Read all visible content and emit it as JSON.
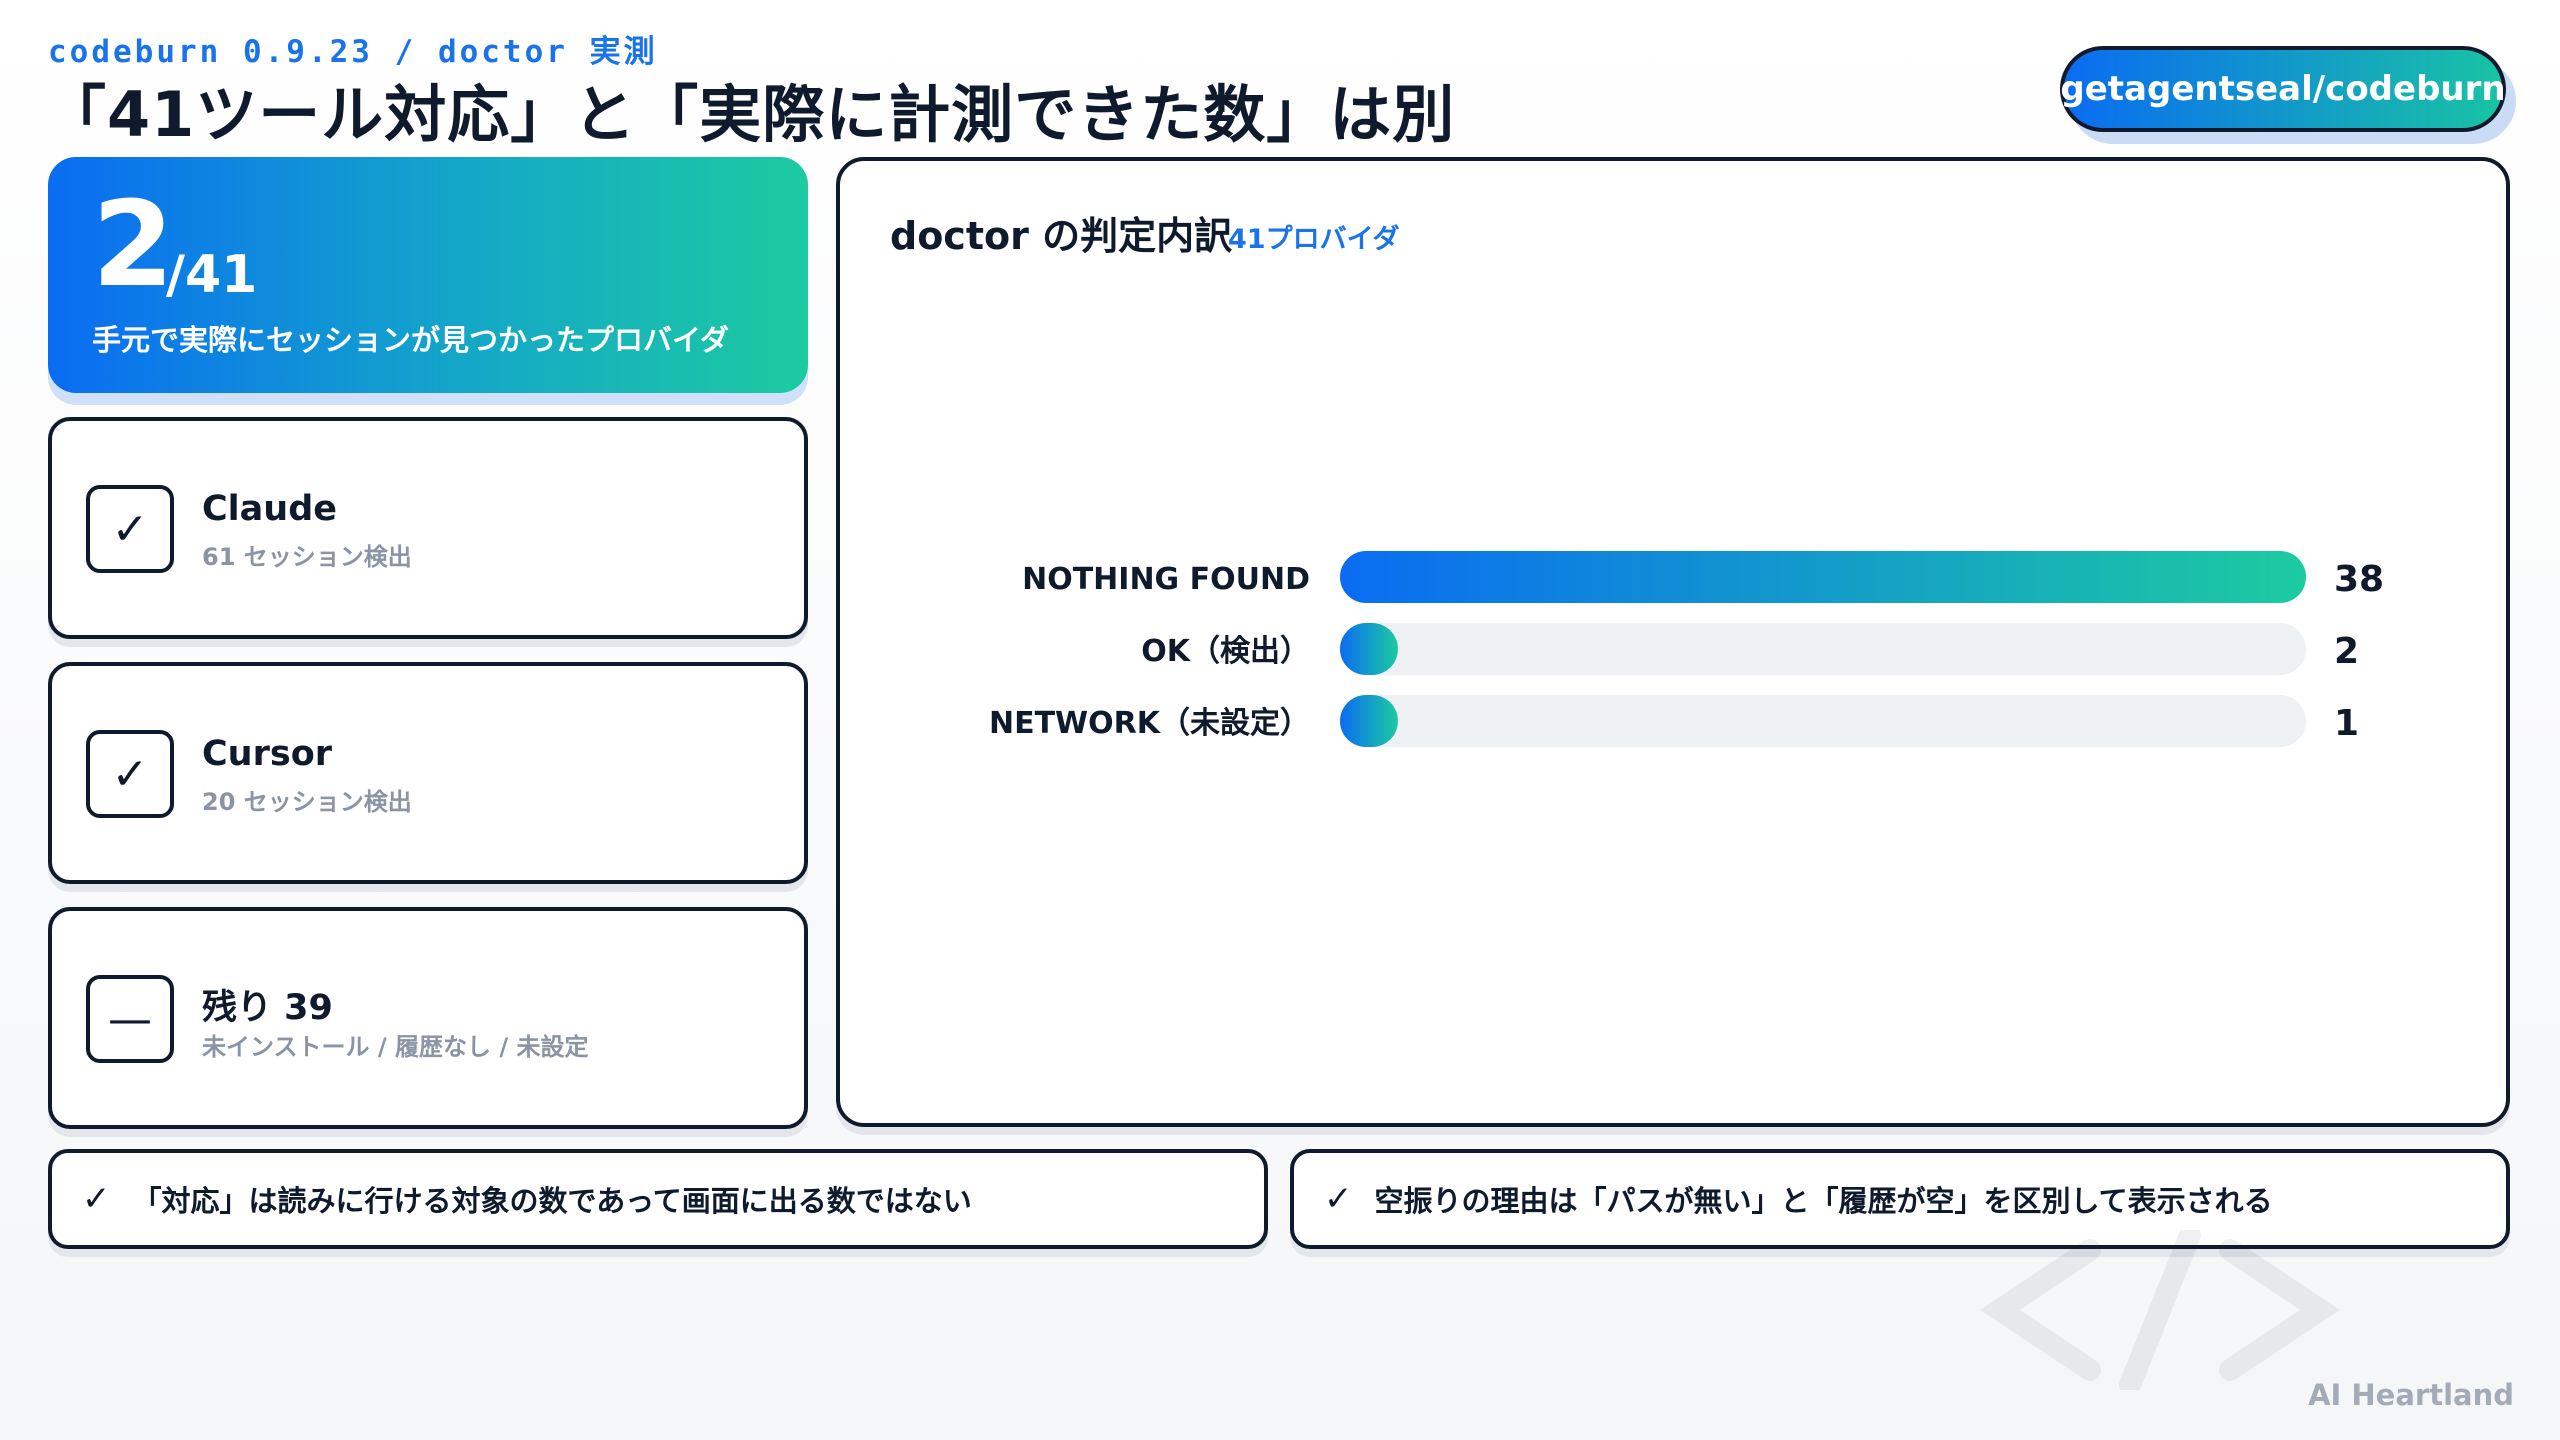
{
  "header": {
    "kicker": "codeburn 0.9.23 / doctor 実測",
    "title": "「41ツール対応」と「実際に計測できた数」は別",
    "repo": "getagentseal/codeburn"
  },
  "hero": {
    "count": "2",
    "total": "/41",
    "caption": "手元で実際にセッションが見つかったプロバイダ"
  },
  "cards": [
    {
      "icon": "check-icon",
      "mark": "✓",
      "name": "Claude",
      "sub": "61 セッション検出"
    },
    {
      "icon": "check-icon",
      "mark": "✓",
      "name": "Cursor",
      "sub": "20 セッション検出"
    },
    {
      "icon": "dash-icon",
      "mark": "—",
      "name": "残り 39",
      "sub": "未インストール / 履歴なし / 未設定"
    }
  ],
  "panel": {
    "title": "doctor の判定内訳",
    "badge": "41プロバイダ"
  },
  "chart_data": {
    "type": "bar",
    "orientation": "horizontal",
    "categories": [
      "NOTHING FOUND",
      "OK（検出）",
      "NETWORK（未設定）"
    ],
    "values": [
      38,
      2,
      1
    ],
    "value_labels": [
      "38",
      "2",
      "1"
    ],
    "xlim": [
      0,
      38
    ],
    "grid": false,
    "colors": {
      "bar_start": "#0a6cf2",
      "bar_end": "#1ccba0",
      "track": "#eef1f4"
    }
  },
  "notes": [
    {
      "tick": "✓",
      "text": "「対応」は読みに行ける対象の数であって画面に出る数ではない"
    },
    {
      "tick": "✓",
      "text": "空振りの理由は「パスが無い」と「履歴が空」を区別して表示される"
    }
  ],
  "footer": {
    "brand": "AI Heartland"
  }
}
